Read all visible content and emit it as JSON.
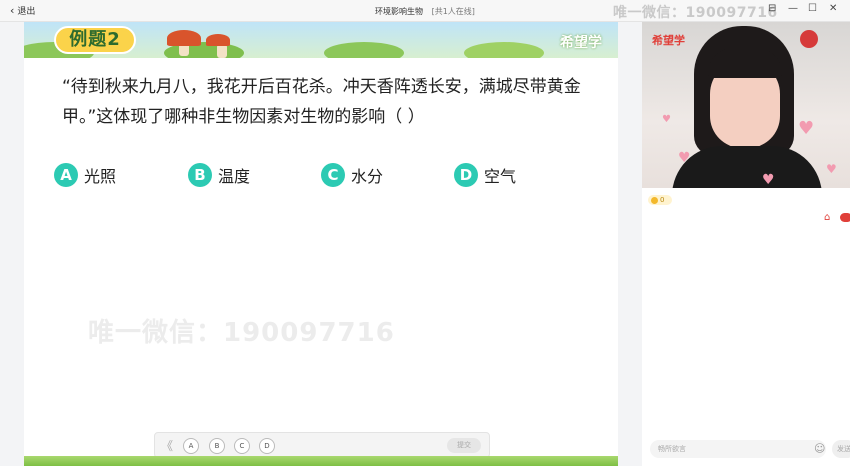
{
  "titlebar": {
    "back_label": "退出",
    "title": "环境影响生物",
    "online": "[共1人在线]",
    "watermark": "唯一微信：19009‍7716"
  },
  "slide": {
    "tag": "例题2",
    "brand": "希望学",
    "question": "“待到秋来九月八，我花开后百花杀。冲天香阵透长安，满城尽带黄金甲。”这体现了哪种非生物因素对生物的影响（    ）",
    "options": [
      {
        "letter": "A",
        "text": "光照"
      },
      {
        "letter": "B",
        "text": "温度"
      },
      {
        "letter": "C",
        "text": "水分"
      },
      {
        "letter": "D",
        "text": "空气"
      }
    ],
    "watermark": "唯一微信：190097716"
  },
  "answer_toolbar": {
    "prev": "《",
    "options": [
      "A",
      "B",
      "C",
      "D"
    ],
    "submit": "提交"
  },
  "video": {
    "brand": "希望学"
  },
  "sidebar": {
    "coins": "0",
    "chat_placeholder": "畅所欲言",
    "send": "发送"
  },
  "colors": {
    "accent_teal": "#2ccab3",
    "tag_yellow": "#fbd34a",
    "brand_red": "#e0403a"
  }
}
